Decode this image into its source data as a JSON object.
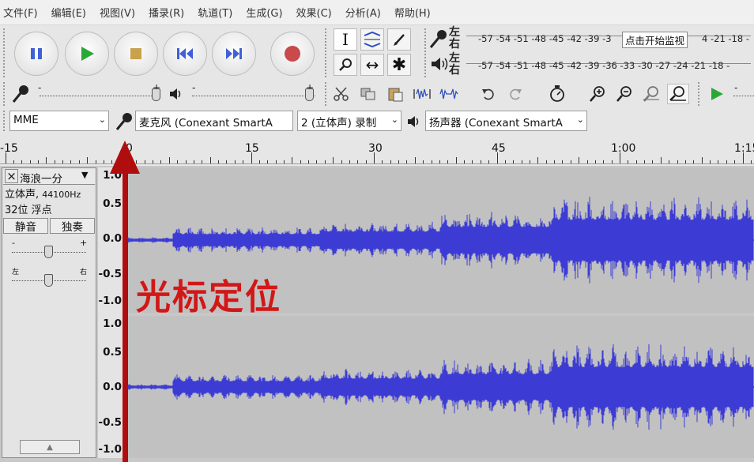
{
  "menu": [
    "文件(F)",
    "编辑(E)",
    "视图(V)",
    "播录(R)",
    "轨道(T)",
    "生成(G)",
    "效果(C)",
    "分析(A)",
    "帮助(H)"
  ],
  "transport": {
    "pause": "pause-icon",
    "play": "play-icon",
    "stop": "stop-icon",
    "skip_start": "skip-start-icon",
    "skip_end": "skip-end-icon",
    "record": "record-icon",
    "colors": {
      "blue": "#4060d8",
      "green": "#2aa835",
      "stop": "#c8a24c",
      "record": "#c84a4a"
    }
  },
  "tools": {
    "selection": "I",
    "envelope": "envelope-icon",
    "draw": "pencil-icon",
    "zoom": "magnifier-icon",
    "timeshift": "↔",
    "multi": "✱"
  },
  "meters": {
    "record_label_l": "左",
    "record_label_r": "右",
    "play_label_l": "左",
    "play_label_r": "右",
    "record_scale_left": "-57 -54 -51 -48 -45 -42 -39 -3",
    "record_monitor": "点击开始监视",
    "record_scale_right": "4 -21 -18 -",
    "play_scale": "-57 -54 -51 -48 -45 -42 -39 -36 -33 -30 -27 -24 -21 -18 -"
  },
  "mixer": {
    "minus": "-",
    "plus": "+"
  },
  "devices": {
    "host": "MME",
    "input": "麦克风 (Conexant SmartA",
    "channels": "2 (立体声) 录制",
    "output": "扬声器 (Conexant SmartA"
  },
  "ruler": {
    "labels": [
      "-15",
      "0",
      "15",
      "30",
      "45",
      "1:00",
      "1:15"
    ]
  },
  "track": {
    "name": "海浪一分",
    "close": "×",
    "menu_arrow": "▼",
    "info_line1": "立体声, ",
    "info_rate": "44100Hz",
    "info_line2": "32位 浮点",
    "mute": "静音",
    "solo": "独奏",
    "gain_minus": "-",
    "gain_plus": "+",
    "pan_left": "左",
    "pan_right": "右",
    "collapse": "▲",
    "scale": [
      "1.0",
      "0.5",
      "0.0",
      "-0.5",
      "-1.0"
    ],
    "wave_color": "#3c3cd4"
  },
  "annotation": "光标定位"
}
